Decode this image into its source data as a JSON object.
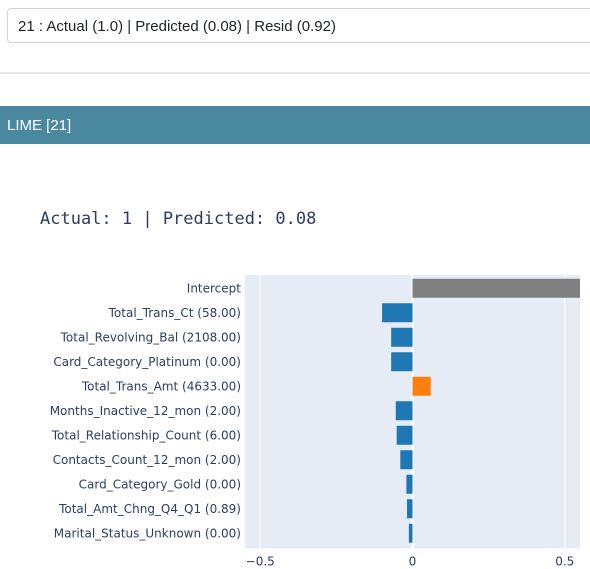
{
  "selector": {
    "selected_value": "21 : Actual (1.0) | Predicted (0.08) | Resid (0.92)"
  },
  "card": {
    "header": "LIME [21]"
  },
  "chart_data": {
    "type": "bar",
    "orientation": "horizontal",
    "title": "Actual: 1 | Predicted: 0.08",
    "categories": [
      "Intercept",
      "Total_Trans_Ct (58.00)",
      "Total_Revolving_Bal (2108.00)",
      "Card_Category_Platinum (0.00)",
      "Total_Trans_Amt (4633.00)",
      "Months_Inactive_12_mon (2.00)",
      "Total_Relationship_Count (6.00)",
      "Contacts_Count_12_mon (2.00)",
      "Card_Category_Gold (0.00)",
      "Total_Amt_Chng_Q4_Q1 (0.89)",
      "Marital_Status_Unknown (0.00)"
    ],
    "values": [
      0.57,
      -0.1,
      -0.07,
      -0.07,
      0.06,
      -0.055,
      -0.052,
      -0.04,
      -0.02,
      -0.018,
      -0.012
    ],
    "colors": {
      "intercept": "#808080",
      "positive": "#ff7f0e",
      "negative": "#1f77b4",
      "plot_bg": "#e5ecf6",
      "grid": "#ffffff"
    },
    "xlim": [
      -0.55,
      0.55
    ],
    "xticks": [
      -0.5,
      0,
      0.5
    ],
    "xtick_labels": [
      "−0.5",
      "0",
      "0.5"
    ],
    "grid": true,
    "xlabel": "",
    "ylabel": ""
  }
}
